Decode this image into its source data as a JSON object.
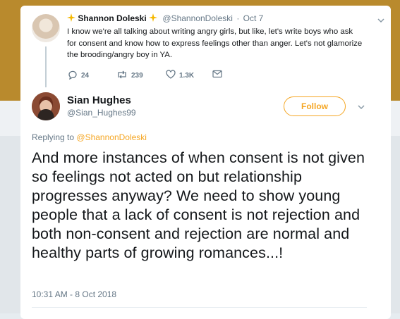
{
  "parent_tweet": {
    "author_name": "Shannon Doleski",
    "author_handle": "@ShannonDoleski",
    "separator": "·",
    "date": "Oct 7",
    "text": "I know we're all talking about writing angry girls, but like, let's write boys who ask for consent and know how to express feelings other than anger. Let's not glamorize the brooding/angry boy in YA.",
    "replies": "24",
    "retweets": "239",
    "likes": "1.3K"
  },
  "main_tweet": {
    "author_name": "Sian Hughes",
    "author_handle": "@Sian_Hughes99",
    "follow_label": "Follow",
    "replying_prefix": "Replying to",
    "replying_to": "@ShannonDoleski",
    "text": "And more instances of when consent is not given so feelings not acted on but relationship progresses anyway? We need to show young people that a lack of consent is not rejection and both non-consent and rejection are normal and healthy parts of growing romances...!",
    "timestamp": "10:31 AM - 8 Oct 2018"
  },
  "colors": {
    "accent": "#f5a623",
    "text_primary": "#14171a",
    "text_secondary": "#657786",
    "background_top": "#b98a2d"
  },
  "icons": [
    "sparkle-emoji-icon",
    "chevron-down-icon",
    "reply-icon",
    "retweet-icon",
    "like-icon",
    "direct-message-icon"
  ]
}
